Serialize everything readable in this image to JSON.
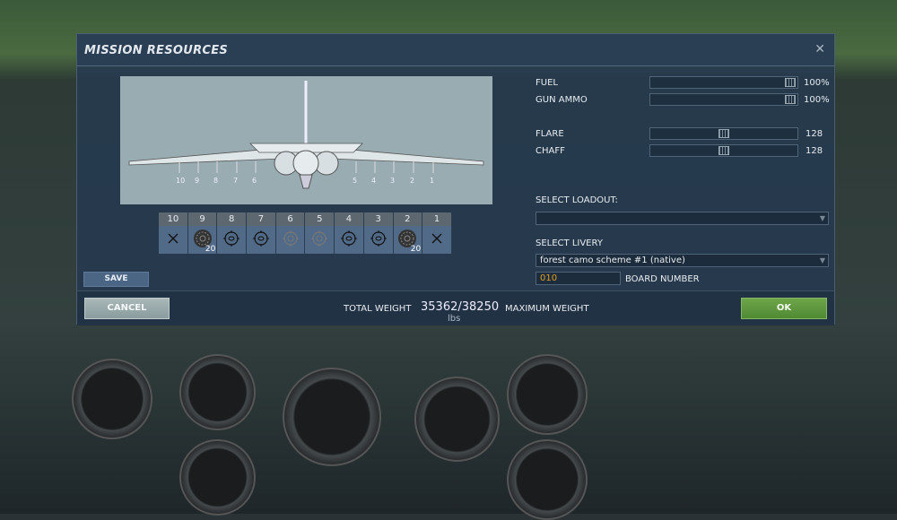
{
  "dialog": {
    "title": "MISSION RESOURCES",
    "close_icon": "close-icon"
  },
  "aircraft": {
    "pylon_labels": [
      "10",
      "9",
      "8",
      "7",
      "6",
      "5",
      "4",
      "3",
      "2",
      "1"
    ]
  },
  "stations": [
    {
      "num": "10",
      "icon": "empty-pylon-icon",
      "qty": ""
    },
    {
      "num": "9",
      "icon": "rocket-pod-icon",
      "qty": "20"
    },
    {
      "num": "8",
      "icon": "bomb-icon",
      "qty": ""
    },
    {
      "num": "7",
      "icon": "bomb-icon",
      "qty": ""
    },
    {
      "num": "6",
      "icon": "fuel-tank-icon",
      "qty": ""
    },
    {
      "num": "5",
      "icon": "fuel-tank-icon",
      "qty": ""
    },
    {
      "num": "4",
      "icon": "bomb-icon",
      "qty": ""
    },
    {
      "num": "3",
      "icon": "bomb-icon",
      "qty": ""
    },
    {
      "num": "2",
      "icon": "rocket-pod-icon",
      "qty": "20"
    },
    {
      "num": "1",
      "icon": "empty-pylon-icon",
      "qty": ""
    }
  ],
  "save_label": "SAVE",
  "resources": {
    "fuel": {
      "label": "FUEL",
      "value": "100%",
      "level": 1.0
    },
    "gun_ammo": {
      "label": "GUN AMMO",
      "value": "100%",
      "level": 1.0
    },
    "flare": {
      "label": "FLARE",
      "value": "128",
      "level": 0.5
    },
    "chaff": {
      "label": "CHAFF",
      "value": "128",
      "level": 0.5
    }
  },
  "loadout": {
    "label": "SELECT LOADOUT:",
    "value": ""
  },
  "livery": {
    "label": "SELECT LIVERY",
    "value": "forest camo scheme #1 (native)"
  },
  "board": {
    "value": "010",
    "label": "BOARD NUMBER"
  },
  "footer": {
    "cancel": "CANCEL",
    "total_weight_label": "TOTAL WEIGHT",
    "total_weight": "35362",
    "max_weight": "38250",
    "separator": "/",
    "unit": "lbs",
    "max_weight_label": "MAXIMUM WEIGHT",
    "ok": "OK"
  },
  "colors": {
    "accent_ok": "#5a9a3c",
    "board_number": "#e0a020"
  }
}
